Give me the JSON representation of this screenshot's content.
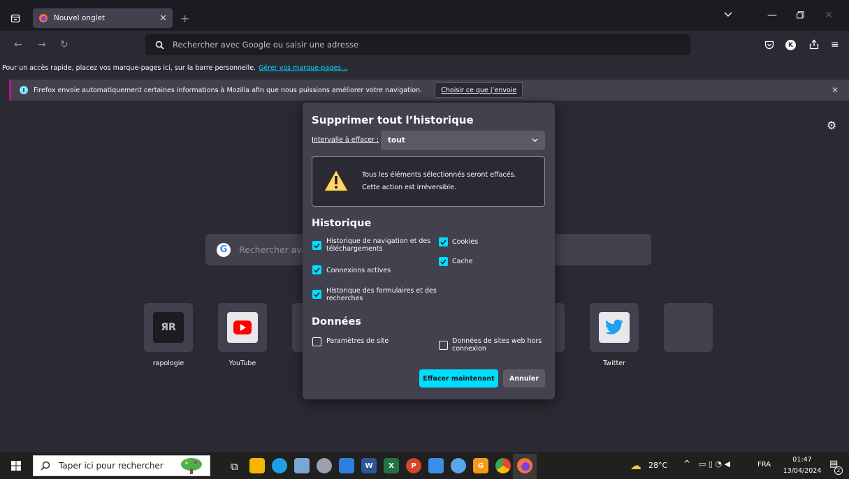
{
  "browser": {
    "tab_title": "Nouvel onglet",
    "url_placeholder": "Rechercher avec Google ou saisir une adresse",
    "bookmarks_text": "Pour un accès rapide, placez vos marque-pages ici, sur la barre personnelle.",
    "bookmarks_link": "Gérer vos marque-pages…",
    "notification_text": "Firefox envoie automatiquement certaines informations à Mozilla afin que nous puissions améliorer votre navigation.",
    "notification_button": "Choisir ce que j’envoie"
  },
  "newtab": {
    "search_placeholder": "Rechercher avec",
    "tiles": [
      {
        "label": "rapologie",
        "icon": "rapologie-icon"
      },
      {
        "label": "YouTube",
        "icon": "youtube-icon"
      },
      {
        "label": "Twitter",
        "icon": "twitter-icon"
      },
      {
        "label": "",
        "icon": "empty-tile"
      }
    ]
  },
  "dialog": {
    "title": "Supprimer tout l’historique",
    "range_label": "Intervalle à effacer :",
    "range_value": "tout",
    "warning_line1": "Tous les éléments sélectionnés seront effacés.",
    "warning_line2": "Cette action est irréversible.",
    "history_section": "Historique",
    "items": {
      "nav_history": {
        "label": "Historique de navigation et des téléchargements",
        "checked": true
      },
      "cookies": {
        "label": "Cookies",
        "checked": true
      },
      "cache": {
        "label": "Cache",
        "checked": true
      },
      "active_logins": {
        "label": "Connexions actives",
        "checked": true
      },
      "form_history": {
        "label": "Historique des formulaires et des recherches",
        "checked": true
      },
      "site_settings": {
        "label": "Paramètres de site",
        "checked": false
      },
      "offline_data": {
        "label": "Données de sites web hors connexion",
        "checked": false
      }
    },
    "data_section": "Données",
    "clear_button": "Effacer maintenant",
    "cancel_button": "Annuler"
  },
  "taskbar": {
    "search_placeholder": "Taper ici pour rechercher",
    "weather": "28°C",
    "language": "FRA",
    "time": "01:47",
    "date": "13/04/2024",
    "notification_count": "2"
  },
  "colors": {
    "accent": "#00ddff",
    "dialog_bg": "#42414d",
    "page_bg": "#2b2a33"
  }
}
